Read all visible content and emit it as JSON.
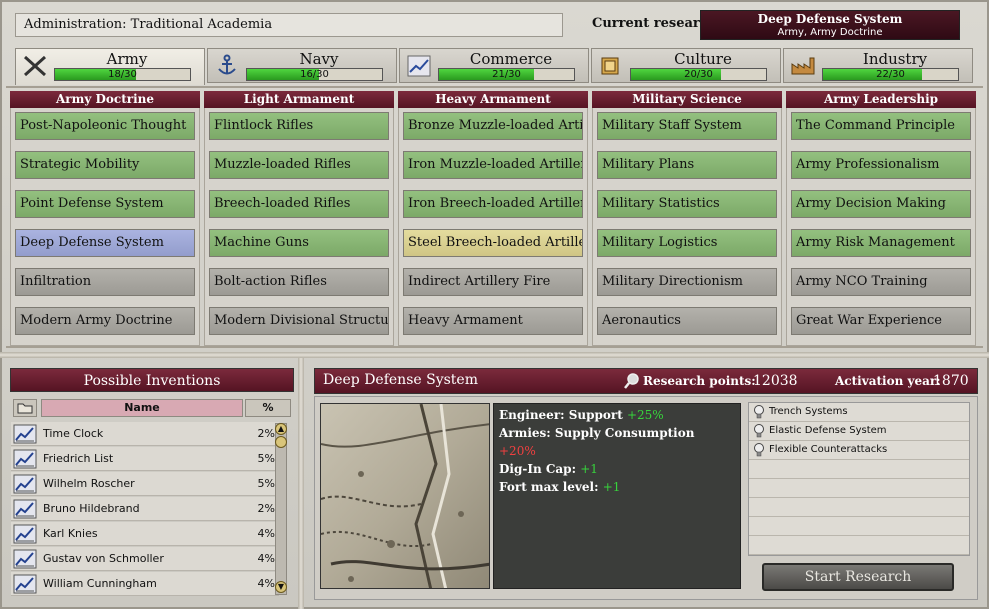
{
  "top": {
    "admin": "Administration:  Traditional Academia",
    "current_label": "Current research:",
    "current_title": "Deep Defense System",
    "current_sub": "Army, Army Doctrine"
  },
  "tabs": [
    {
      "name": "Army",
      "progress": "18/30",
      "fraction": 0.6,
      "icon": "crossed-swords-icon"
    },
    {
      "name": "Navy",
      "progress": "16/30",
      "fraction": 0.53,
      "icon": "anchor-icon"
    },
    {
      "name": "Commerce",
      "progress": "21/30",
      "fraction": 0.7,
      "icon": "trend-chart-icon"
    },
    {
      "name": "Culture",
      "progress": "20/30",
      "fraction": 0.67,
      "icon": "books-icon"
    },
    {
      "name": "Industry",
      "progress": "22/30",
      "fraction": 0.73,
      "icon": "factory-icon"
    }
  ],
  "columns": [
    {
      "title": "Army Doctrine",
      "techs": [
        {
          "name": "Post-Napoleonic Thought",
          "state": "researched"
        },
        {
          "name": "Strategic Mobility",
          "state": "researched"
        },
        {
          "name": "Point Defense System",
          "state": "researched"
        },
        {
          "name": "Deep Defense System",
          "state": "current"
        },
        {
          "name": "Infiltration",
          "state": "locked"
        },
        {
          "name": "Modern Army Doctrine",
          "state": "locked"
        }
      ]
    },
    {
      "title": "Light Armament",
      "techs": [
        {
          "name": "Flintlock Rifles",
          "state": "researched"
        },
        {
          "name": "Muzzle-loaded Rifles",
          "state": "researched"
        },
        {
          "name": "Breech-loaded Rifles",
          "state": "researched"
        },
        {
          "name": "Machine Guns",
          "state": "researched"
        },
        {
          "name": "Bolt-action Rifles",
          "state": "locked"
        },
        {
          "name": "Modern Divisional Structure",
          "state": "locked"
        }
      ]
    },
    {
      "title": "Heavy Armament",
      "techs": [
        {
          "name": "Bronze Muzzle-loaded Arti ...",
          "state": "researched"
        },
        {
          "name": "Iron Muzzle-loaded Artillery",
          "state": "researched"
        },
        {
          "name": "Iron Breech-loaded Artillery",
          "state": "researched"
        },
        {
          "name": "Steel Breech-loaded Artillery",
          "state": "selected"
        },
        {
          "name": "Indirect Artillery Fire",
          "state": "locked"
        },
        {
          "name": "Heavy Armament",
          "state": "locked"
        }
      ]
    },
    {
      "title": "Military Science",
      "techs": [
        {
          "name": "Military Staff System",
          "state": "researched"
        },
        {
          "name": "Military Plans",
          "state": "researched"
        },
        {
          "name": "Military Statistics",
          "state": "researched"
        },
        {
          "name": "Military Logistics",
          "state": "researched"
        },
        {
          "name": "Military Directionism",
          "state": "locked"
        },
        {
          "name": "Aeronautics",
          "state": "locked"
        }
      ]
    },
    {
      "title": "Army Leadership",
      "techs": [
        {
          "name": "The Command Principle",
          "state": "researched"
        },
        {
          "name": "Army Professionalism",
          "state": "researched"
        },
        {
          "name": "Army Decision Making",
          "state": "researched"
        },
        {
          "name": "Army Risk Management",
          "state": "researched"
        },
        {
          "name": "Army NCO Training",
          "state": "locked"
        },
        {
          "name": "Great War Experience",
          "state": "locked"
        }
      ]
    }
  ],
  "inventions": {
    "title": "Possible Inventions",
    "col_name": "Name",
    "col_pct": "%",
    "items": [
      {
        "name": "Time Clock",
        "pct": "2%"
      },
      {
        "name": "Friedrich List",
        "pct": "5%"
      },
      {
        "name": "Wilhelm Roscher",
        "pct": "5%"
      },
      {
        "name": "Bruno Hildebrand",
        "pct": "2%"
      },
      {
        "name": "Karl Knies",
        "pct": "4%"
      },
      {
        "name": "Gustav von Schmoller",
        "pct": "4%"
      },
      {
        "name": "William Cunningham",
        "pct": "4%"
      }
    ]
  },
  "detail": {
    "title": "Deep Defense System",
    "rp_label": "Research points:",
    "rp_value": "12038",
    "ay_label": "Activation year:",
    "ay_value": "1870",
    "effects": [
      {
        "label": "Engineer: Support",
        "value": "+25%",
        "sign": "pos"
      },
      {
        "label": "Armies: Supply Consumption",
        "value": "+20%",
        "sign": "neg"
      },
      {
        "label": "Dig-In Cap:",
        "value": "+1",
        "sign": "pos"
      },
      {
        "label": "Fort max level:",
        "value": "+1",
        "sign": "pos"
      }
    ],
    "unlocks": [
      "Trench Systems",
      "Elastic Defense System",
      "Flexible Counterattacks"
    ],
    "start_button": "Start Research"
  }
}
